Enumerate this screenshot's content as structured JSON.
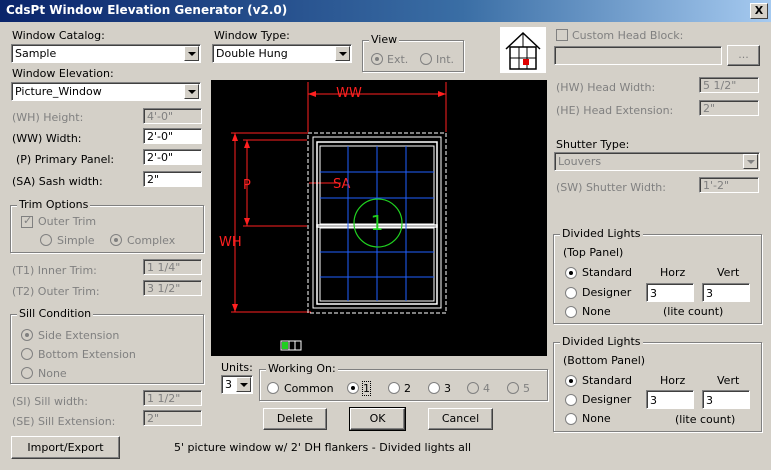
{
  "window": {
    "title": "CdsPt Window Elevation Generator (v2.0)",
    "close": "X"
  },
  "left": {
    "catalog_label": "Window Catalog:",
    "catalog_value": "Sample",
    "elevation_label": "Window Elevation:",
    "elevation_value": "Picture_Window",
    "height_label": "(WH) Height:",
    "height_value": "4'-0\"",
    "width_label": "(WW) Width:",
    "width_value": "2'-0\"",
    "primary_label": "(P) Primary Panel:",
    "primary_value": "2'-0\"",
    "sash_label": "(SA) Sash width:",
    "sash_value": "2\"",
    "trim_group": "Trim Options",
    "outer_trim": "Outer Trim",
    "simple": "Simple",
    "complex": "Complex",
    "inner_trim_label": "(T1) Inner Trim:",
    "inner_trim_value": "1 1/4\"",
    "outer_trim_label": "(T2) Outer Trim:",
    "outer_trim_value": "3 1/2\"",
    "sill_group": "Sill Condition",
    "side_ext": "Side Extension",
    "bottom_ext": "Bottom Extension",
    "none": "None",
    "sill_width_label": "(SI) Sill width:",
    "sill_width_value": "1 1/2\"",
    "sill_ext_label": "(SE) Sill Extension:",
    "sill_ext_value": "2\"",
    "import_btn": "Import/Export"
  },
  "middle": {
    "type_label": "Window Type:",
    "type_value": "Double Hung",
    "view_group": "View",
    "view_ext": "Ext.",
    "view_int": "Int.",
    "units_label": "Units:",
    "units_value": "3",
    "working_group": "Working On:",
    "working_common": "Common",
    "working_opts": [
      "1",
      "2",
      "3",
      "4",
      "5"
    ],
    "delete_btn": "Delete",
    "ok_btn": "OK",
    "cancel_btn": "Cancel",
    "status": "5' picture window w/ 2' DH flankers - Divided lights all"
  },
  "drawing": {
    "ww": "WW",
    "wh": "WH",
    "p": "P",
    "sa": "SA",
    "panel": "1",
    "colors": {
      "dim": "#ff2020",
      "frame": "#ffffff",
      "grid": "#2060ff",
      "marker": "#20d020"
    }
  },
  "right": {
    "custom_head": "Custom Head Block:",
    "browse": "...",
    "head_width_label": "(HW) Head Width:",
    "head_width_value": "5 1/2\"",
    "head_ext_label": "(HE) Head Extension:",
    "head_ext_value": "2\"",
    "shutter_type_label": "Shutter Type:",
    "shutter_type_value": "Louvers",
    "shutter_width_label": "(SW) Shutter Width:",
    "shutter_width_value": "1'-2\"",
    "top_group": "Divided Lights",
    "top_sub": "(Top Panel)",
    "bottom_group": "Divided Lights",
    "bottom_sub": "(Bottom Panel)",
    "horz": "Horz",
    "vert": "Vert",
    "standard": "Standard",
    "designer": "Designer",
    "none": "None",
    "lite_count": "(lite count)",
    "top_horz": "3",
    "top_vert": "3",
    "bottom_horz": "3",
    "bottom_vert": "3"
  }
}
